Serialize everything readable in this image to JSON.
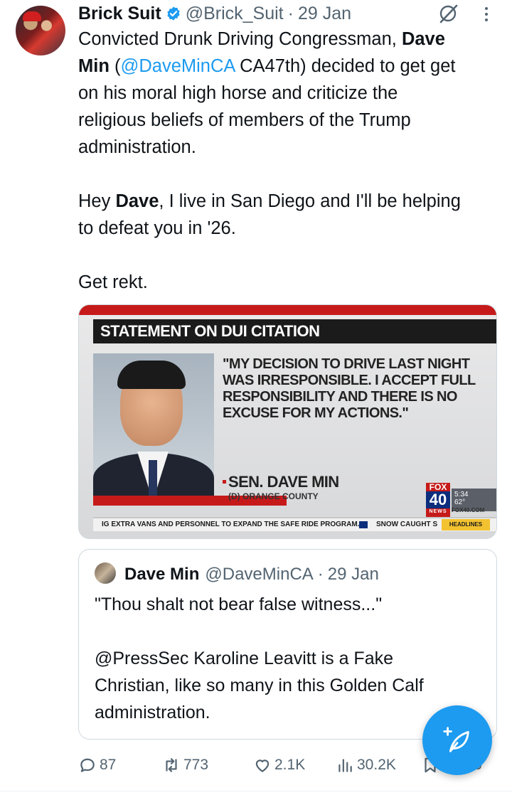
{
  "tweet": {
    "author_name": "Brick Suit",
    "handle": "@Brick_Suit",
    "separator": "·",
    "time": "29 Jan",
    "body": {
      "l1": "Convicted Drunk Driving Congressman, ",
      "l1_bold": "Dave",
      "l2_bold": "Min",
      "l2_a": " (",
      "l2_mention": "@DaveMinCA",
      "l2_b": " CA47th) decided to get get",
      "l3": "on his moral high horse and criticize the",
      "l4": "religious beliefs of members of the Trump",
      "l5": "administration.",
      "p2_a": "Hey ",
      "p2_bold": "Dave",
      "p2_b": ", I live in San Diego and I'll be helping",
      "p2_l2": "to defeat you in '26.",
      "p3": "Get rekt."
    }
  },
  "media": {
    "headline": "STATEMENT ON DUI CITATION",
    "quote": "\"MY DECISION TO DRIVE LAST NIGHT WAS IRRESPONSIBLE. I ACCEPT FULL RESPONSIBILITY AND THERE IS NO EXCUSE FOR MY ACTIONS.\"",
    "speaker": "SEN. DAVE MIN",
    "speaker_sub": "(D) ORANGE COUNTY",
    "station_top": "FOX",
    "station_num": "40",
    "station_news": "NEWS",
    "clock_time": "5:34",
    "clock_temp": "62°",
    "site": "FOX40.COM",
    "ticker_left": "IG EXTRA VANS AND PERSONNEL TO EXPAND THE SAFE RIDE PROGRAM.",
    "ticker_right": "SNOW CAUGHT S",
    "ticker_tag": "HEADLINES"
  },
  "quoted": {
    "author_name": "Dave Min",
    "handle": "@DaveMinCA",
    "separator": "·",
    "time": "29 Jan",
    "p1": "\"Thou shalt not bear false witness...\"",
    "p2_l1": "@PressSec Karoline Leavitt is a Fake",
    "p2_l2": "Christian, like so many in this Golden Calf",
    "p2_l3": "administration."
  },
  "actions": {
    "replies": "87",
    "reposts": "773",
    "likes": "2.1K",
    "views": "30.2K",
    "share_partial": "6"
  },
  "colors": {
    "accent": "#1d9bf0",
    "text": "#0f1419",
    "muted": "#536471",
    "border": "#cfd9de"
  },
  "icons": [
    "verified-badge-icon",
    "grok-icon",
    "more-icon",
    "reply-icon",
    "repost-icon",
    "like-icon",
    "views-icon",
    "bookmark-icon",
    "compose-icon"
  ]
}
